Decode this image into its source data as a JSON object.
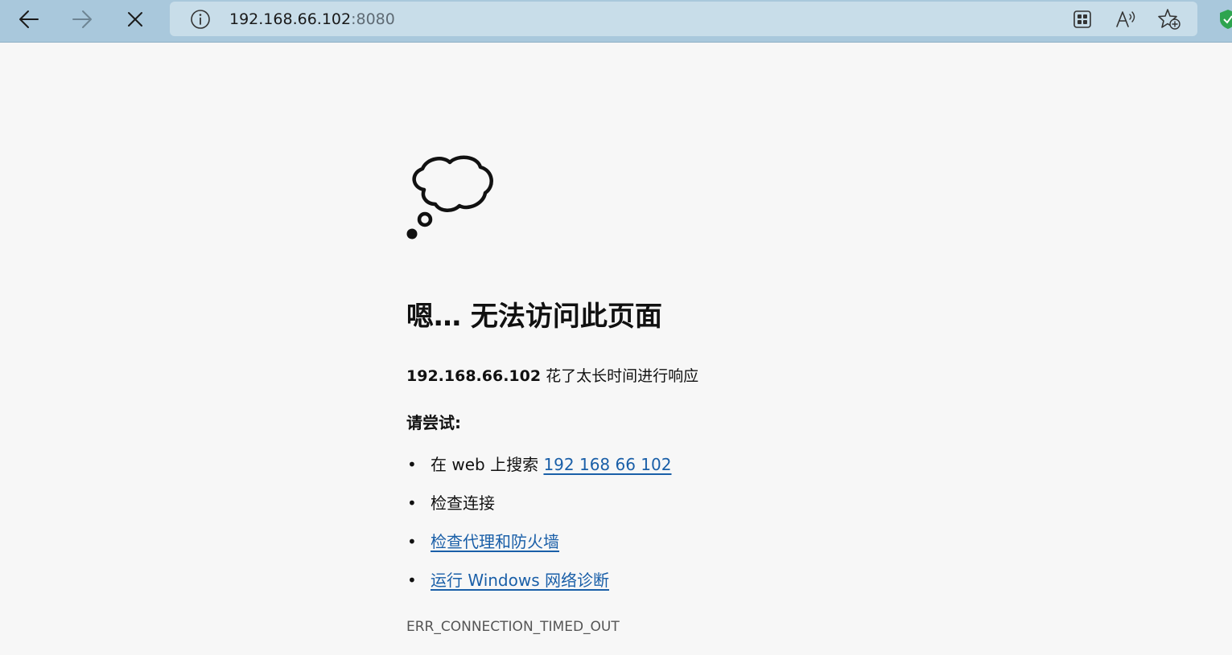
{
  "browser": {
    "url_host": "192.168.66.102",
    "url_port": ":8080",
    "icons": {
      "back": "back-arrow-icon",
      "forward": "forward-arrow-icon",
      "stop": "close-icon",
      "site_info": "info-icon",
      "apps": "apps-icon",
      "read_aloud": "read-aloud-icon",
      "favorite": "add-favorite-icon",
      "extension": "shield-icon"
    },
    "colors": {
      "toolbar": "#a9c8dc",
      "address_bar": "#c8dde9",
      "extension_shield": "#2ea44f"
    }
  },
  "error_page": {
    "illustration": "thought-cloud-icon",
    "heading": "嗯… 无法访问此页面",
    "host": "192.168.66.102",
    "message": "花了太长时间进行响应",
    "try_label": "请尝试:",
    "suggestions": [
      {
        "prefix": "在 web 上搜索 ",
        "link": "192 168 66 102"
      },
      {
        "text": "检查连接"
      },
      {
        "link": "检查代理和防火墙"
      },
      {
        "link": "运行 Windows 网络诊断"
      }
    ],
    "bullet": "•",
    "error_code": "ERR_CONNECTION_TIMED_OUT",
    "colors": {
      "background": "#f7f7f7",
      "link": "#1a5fa8",
      "text": "#111111"
    }
  }
}
